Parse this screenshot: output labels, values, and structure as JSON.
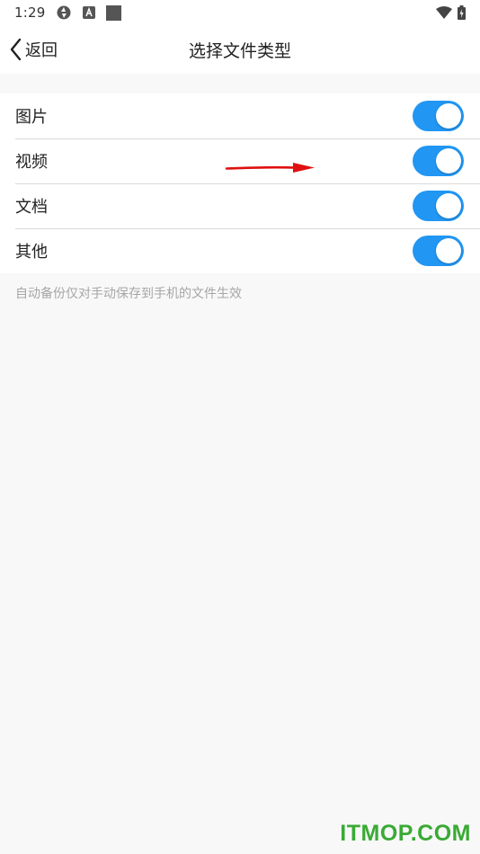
{
  "status_bar": {
    "time": "1:29",
    "icons": [
      "sync-icon",
      "a-badge-icon",
      "square-icon",
      "wifi-icon",
      "battery-charging-icon"
    ]
  },
  "header": {
    "back_label": "返回",
    "title": "选择文件类型"
  },
  "file_types": [
    {
      "label": "图片",
      "enabled": true
    },
    {
      "label": "视频",
      "enabled": true
    },
    {
      "label": "文档",
      "enabled": true
    },
    {
      "label": "其他",
      "enabled": true
    }
  ],
  "hint": "自动备份仅对手动保存到手机的文件生效",
  "watermark": "ITMOP.COM",
  "colors": {
    "toggle_on": "#2196f3",
    "annotation_arrow": "#e01010",
    "watermark": "#3aaa35"
  }
}
